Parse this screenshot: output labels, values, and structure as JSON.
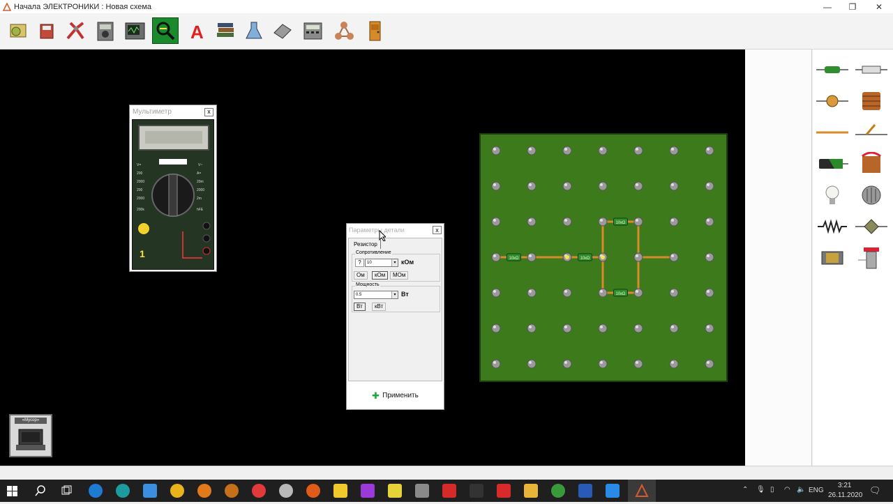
{
  "window": {
    "title": "Начала ЭЛЕКТРОНИКИ : Новая схема",
    "minimize": "—",
    "maximize": "❐",
    "close": "✕"
  },
  "toolbar": {
    "buttons": [
      "open-scheme",
      "save-scheme",
      "pliers-tool",
      "multimeter-tool",
      "oscilloscope-tool",
      "zoom-tool",
      "text-tool",
      "library",
      "lab-flask",
      "eraser",
      "calculator",
      "molecule",
      "door-exit"
    ],
    "active_index": 5
  },
  "multimeter": {
    "title": "Мультиметр",
    "reading": "1",
    "close": "x"
  },
  "params_dialog": {
    "title": "Параметры детали",
    "tab": "Резистор",
    "close": "x",
    "resistance": {
      "label": "Сопротивление",
      "help": "?",
      "value": "10",
      "unit": "кОм",
      "buttons": [
        "Ом",
        "кОм",
        "МОм"
      ]
    },
    "power": {
      "label": "Мощность",
      "value": "0.5",
      "unit": "Вт",
      "buttons": [
        "Вт",
        "кВт"
      ]
    },
    "apply": "Применить"
  },
  "breadboard": {
    "resistor_label": "10кΩ",
    "colors": {
      "board": "#3d7a1c",
      "wire": "#d98a2a",
      "resistor": "#2f8f2f"
    }
  },
  "trash": {
    "label": "«Мусор»"
  },
  "palette": {
    "items": [
      "resistor",
      "fuse",
      "potentiometer",
      "inductor",
      "wire",
      "switch",
      "battery",
      "capacitor-electrolytic",
      "lamp",
      "transformer",
      "coil",
      "variable-resistor",
      "motor",
      "relay"
    ]
  },
  "taskbar": {
    "lang": "ENG",
    "time": "3:21",
    "date": "26.11.2020"
  }
}
